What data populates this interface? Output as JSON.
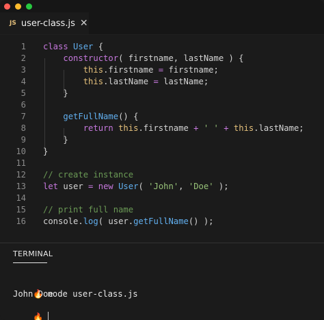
{
  "window": {
    "controls": [
      "close",
      "minimize",
      "maximize"
    ]
  },
  "tab": {
    "badge": "JS",
    "filename": "user-class.js",
    "close_glyph": "✕"
  },
  "editor": {
    "line_numbers": [
      "1",
      "2",
      "3",
      "4",
      "5",
      "6",
      "7",
      "8",
      "9",
      "10",
      "11",
      "12",
      "13",
      "14",
      "15",
      "16"
    ],
    "lines": [
      "class User {",
      "    constructor( firstname, lastName ) {",
      "        this.firstname = firstname;",
      "        this.lastName = lastName;",
      "    }",
      "",
      "    getFullName() {",
      "        return this.firstname + ' ' + this.lastName;",
      "    }",
      "}",
      "",
      "// create instance",
      "let user = new User( 'John', 'Doe' );",
      "",
      "// print full name",
      "console.log( user.getFullName() );"
    ]
  },
  "terminal": {
    "title": "TERMINAL",
    "prompt_icon": "🔥",
    "command": "node user-class.js",
    "output": "John Doe"
  },
  "colors": {
    "keyword": "#c678dd",
    "function": "#61afef",
    "this": "#e5c07b",
    "comment": "#6a9955",
    "string": "#98c379",
    "background": "#1b1b1b"
  }
}
